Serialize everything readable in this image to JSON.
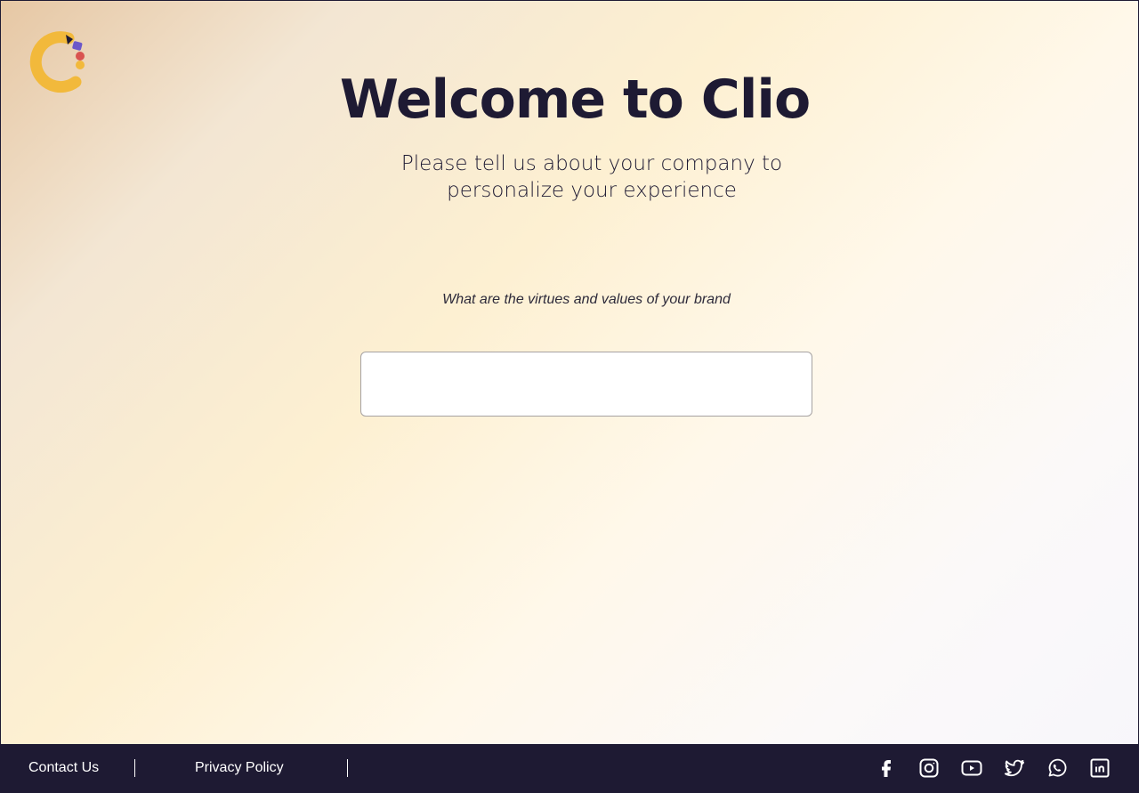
{
  "header": {
    "title": "Welcome to Clio",
    "subtitle": "Please tell us about your company to personalize your experience"
  },
  "logo": {
    "icon": "clio-logo-icon",
    "colors": [
      "#f2b93b",
      "#1e1a33",
      "#6b57c9",
      "#d9534f"
    ]
  },
  "form": {
    "question": "What are the virtues and values of your brand",
    "answer_value": ""
  },
  "footer": {
    "links": [
      {
        "label": "Contact Us"
      },
      {
        "label": "Privacy Policy"
      }
    ],
    "social_icons": [
      "facebook-icon",
      "instagram-icon",
      "youtube-icon",
      "twitter-icon",
      "whatsapp-icon",
      "linkedin-icon"
    ]
  },
  "colors": {
    "brand_dark": "#1e1a33",
    "brand_accent": "#f2b93b"
  }
}
